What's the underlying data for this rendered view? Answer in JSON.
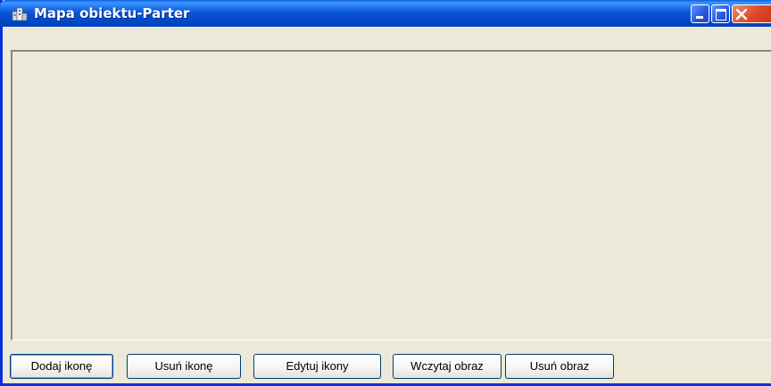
{
  "window": {
    "title": "Mapa obiektu-Parter",
    "icon": "building-map-icon"
  },
  "title_buttons": {
    "minimize": "minimize-icon",
    "maximize": "maximize-icon",
    "close": "close-icon"
  },
  "toolbar": {
    "add_icon_label": "Dodaj ikonę",
    "remove_icon_label": "Usuń ikonę",
    "edit_icons_label": "Edytuj ikony",
    "load_image_label": "Wczytaj obraz",
    "remove_image_label": "Usuń obraz"
  },
  "colors": {
    "titlebar": "#0a58d8",
    "window_bg": "#ece9d8",
    "close_button": "#e0492a"
  }
}
